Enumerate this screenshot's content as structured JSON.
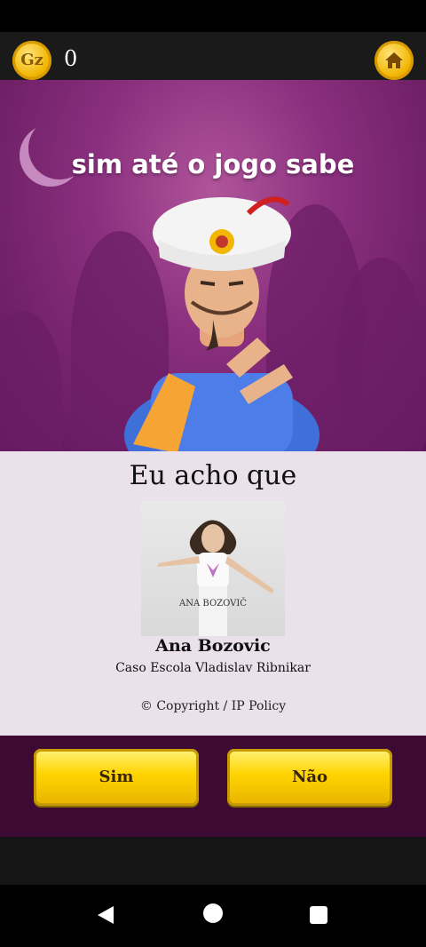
{
  "header": {
    "coin_icon_label": "Gz",
    "coin_count": "0",
    "home_icon": "home-icon"
  },
  "scene": {
    "dialog_text": "sim até o jogo sabe"
  },
  "guess": {
    "title": "Eu acho que",
    "photo_caption": "ANA BOZOVIČ",
    "name": "Ana Bozovic",
    "description": "Caso Escola Vladislav Ribnikar",
    "copyright": "© Copyright / IP Policy"
  },
  "actions": {
    "yes_label": "Sim",
    "no_label": "Não"
  },
  "navbar": {
    "back_icon": "back-triangle-icon",
    "home_icon": "home-circle-icon",
    "recent_icon": "recents-square-icon"
  },
  "colors": {
    "accent_gold": "#ffd400",
    "scene_purple": "#8a2f7e",
    "actions_bg": "#3c0a33"
  }
}
